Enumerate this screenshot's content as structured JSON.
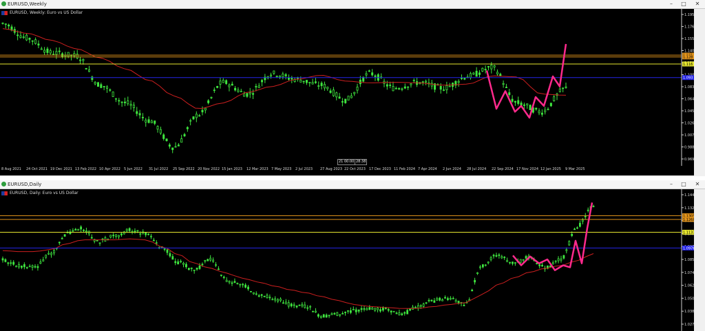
{
  "top": {
    "window_title": "EURUSD,Weekly",
    "info": "EURUSD, Weekly:  Euro vs US Dollar",
    "price_ticks": [
      "1.195",
      "1.176",
      "1.155",
      "1.140",
      "1.120",
      "1.100",
      "1.083",
      "1.064",
      "1.045",
      "1.026",
      "1.007",
      "0.988",
      "0.969"
    ],
    "price_tags": [
      "1.131",
      "1.128",
      "1.116",
      "1.093"
    ],
    "date_ticks": [
      "8 Aug 2021",
      "24 Oct 2021",
      "19 Dec 2021",
      "13 Feb 2022",
      "10 Apr 2022",
      "5 Jun 2022",
      "31 Jul 2022",
      "25 Sep 2022",
      "20 Nov 2022",
      "15 Jan 2023",
      "12 Mar 2023",
      "7 May 2023",
      "2 Jul 2023",
      "27 Aug 2023",
      "22 Oct 2023",
      "17 Dec 2023",
      "11 Feb 2024",
      "7 Apr 2024",
      "2 Jun 2024",
      "28 Jul 2024",
      "22 Sep 2024",
      "17 Nov 2024",
      "12 Jan 2025",
      "9 Mar 2025"
    ],
    "crosshair": [
      "21 00:00",
      "28:38"
    ]
  },
  "bottom": {
    "window_title": "EURUSD,Daily",
    "info": "EURUSD, Daily:  Euro vs US Dollar",
    "price_ticks": [
      "1.14465",
      "1.13290",
      "1.12115",
      "1.10940",
      "1.09765",
      "1.08590",
      "1.07405",
      "1.06240",
      "1.05065",
      "1.03890",
      "1.02715"
    ],
    "price_tags": [
      "1.13057",
      "1.12684",
      "1.11377",
      "1.09765"
    ]
  },
  "colors": {
    "background": "#000000",
    "candles": "#3fe63f",
    "moving_average": "#cc1f1f",
    "pattern": "#ff2a8c",
    "level_orange": "#e0921a",
    "level_yellow": "#e6e62e",
    "level_blue": "#2424e8"
  },
  "chart_data": [
    {
      "type": "candlestick",
      "title": "EURUSD,Weekly",
      "ylim": [
        0.955,
        1.2
      ],
      "x": [
        "8 Aug 2021",
        "24 Oct 2021",
        "19 Dec 2021",
        "13 Feb 2022",
        "10 Apr 2022",
        "5 Jun 2022",
        "31 Jul 2022",
        "25 Sep 2022",
        "20 Nov 2022",
        "15 Jan 2023",
        "12 Mar 2023",
        "7 May 2023",
        "2 Jul 2023",
        "27 Aug 2023",
        "22 Oct 2023",
        "17 Dec 2023",
        "11 Feb 2024",
        "7 Apr 2024",
        "2 Jun 2024",
        "28 Jul 2024",
        "22 Sep 2024",
        "17 Nov 2024",
        "12 Jan 2025",
        "9 Mar 2025"
      ],
      "series": [
        {
          "values": [
            1.185,
            1.16,
            1.135,
            1.13,
            1.08,
            1.05,
            1.02,
            0.975,
            1.03,
            1.085,
            1.065,
            1.1,
            1.09,
            1.08,
            1.055,
            1.1,
            1.075,
            1.085,
            1.075,
            1.095,
            1.11,
            1.05,
            1.035,
            1.075
          ]
        },
        {
          "values": [
            1.176,
            1.168,
            1.156,
            1.142,
            1.126,
            1.108,
            1.088,
            1.062,
            1.04,
            1.05,
            1.068,
            1.078,
            1.09,
            1.097,
            1.087,
            1.084,
            1.085,
            1.084,
            1.08,
            1.082,
            1.096,
            1.094,
            1.065,
            1.063
          ]
        }
      ],
      "levels": [
        1.131,
        1.128,
        1.116,
        1.093
      ]
    },
    {
      "type": "candlestick",
      "title": "EURUSD,Daily",
      "ylim": [
        1.02,
        1.152
      ],
      "series": [
        {
          "values": [
            1.085,
            1.08,
            1.078,
            1.092,
            1.112,
            1.118,
            1.104,
            1.11,
            1.116,
            1.112,
            1.098,
            1.083,
            1.075,
            1.087,
            1.065,
            1.06,
            1.05,
            1.046,
            1.04,
            1.038,
            1.028,
            1.03,
            1.034,
            1.036,
            1.035,
            1.03,
            1.038,
            1.044,
            1.046,
            1.04,
            1.08,
            1.09,
            1.082,
            1.088,
            1.078,
            1.087,
            1.12,
            1.14
          ]
        },
        {
          "values": [
            1.095,
            1.094,
            1.094,
            1.096,
            1.102,
            1.106,
            1.106,
            1.106,
            1.107,
            1.106,
            1.099,
            1.091,
            1.082,
            1.077,
            1.072,
            1.067,
            1.063,
            1.059,
            1.055,
            1.052,
            1.048,
            1.044,
            1.04,
            1.038,
            1.037,
            1.036,
            1.036,
            1.038,
            1.04,
            1.042,
            1.05,
            1.06,
            1.067,
            1.073,
            1.077,
            1.08,
            1.085,
            1.092
          ]
        }
      ],
      "levels": [
        1.13057,
        1.12684,
        1.11377,
        1.09765
      ]
    }
  ]
}
